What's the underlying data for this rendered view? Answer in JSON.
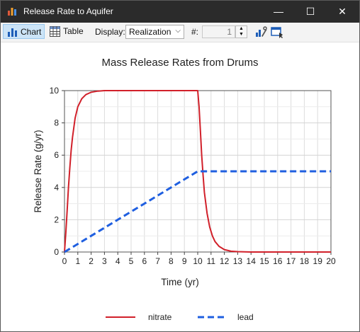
{
  "window": {
    "title": "Release Rate to Aquifer",
    "minimize": "—",
    "maximize": "☐",
    "close": "✕"
  },
  "toolbar": {
    "chart_label": "Chart",
    "table_label": "Table",
    "display_label": "Display:",
    "display_value": "Realization",
    "count_label": "#:",
    "count_value": "1"
  },
  "colors": {
    "nitrate": "#d1202a",
    "lead": "#1f5fe0"
  },
  "chart_data": {
    "type": "line",
    "title": "Mass Release Rates from Drums",
    "xlabel": "Time (yr)",
    "ylabel": "Release Rate (g/yr)",
    "xlim": [
      0,
      20
    ],
    "ylim": [
      0,
      10
    ],
    "xticks": [
      0,
      1,
      2,
      3,
      4,
      5,
      6,
      7,
      8,
      9,
      10,
      11,
      12,
      13,
      14,
      15,
      16,
      17,
      18,
      19,
      20
    ],
    "yticks": [
      0,
      2,
      4,
      6,
      8,
      10
    ],
    "grid": true,
    "legend": "bottom",
    "series": [
      {
        "name": "nitrate",
        "style": "solid",
        "x": [
          0,
          0.1,
          0.2,
          0.3,
          0.4,
          0.5,
          0.6,
          0.8,
          1,
          1.3,
          1.6,
          2,
          2.5,
          3,
          4,
          5,
          6,
          7,
          8,
          9,
          10,
          10.1,
          10.2,
          10.3,
          10.4,
          10.5,
          10.7,
          10.9,
          11.1,
          11.3,
          11.6,
          12,
          12.5,
          13,
          14,
          15,
          16,
          17,
          18,
          19,
          20
        ],
        "y": [
          0,
          1.2,
          2.6,
          4,
          5.2,
          6.3,
          7.1,
          8.3,
          9,
          9.5,
          9.75,
          9.9,
          9.97,
          10,
          10,
          10,
          10,
          10,
          10,
          10,
          10,
          9,
          7.5,
          6,
          4.8,
          3.7,
          2.4,
          1.55,
          1,
          0.65,
          0.35,
          0.15,
          0.05,
          0.02,
          0,
          0,
          0,
          0,
          0,
          0,
          0
        ]
      },
      {
        "name": "lead",
        "style": "dashed",
        "x": [
          0,
          1,
          2,
          3,
          4,
          5,
          6,
          7,
          8,
          9,
          10,
          10.3,
          11,
          12,
          13,
          14,
          15,
          16,
          17,
          18,
          19,
          20
        ],
        "y": [
          0,
          0.5,
          1,
          1.5,
          2,
          2.5,
          3,
          3.5,
          4,
          4.5,
          5,
          5,
          5,
          5,
          5,
          5,
          5,
          5,
          5,
          5,
          5,
          5
        ]
      }
    ]
  }
}
